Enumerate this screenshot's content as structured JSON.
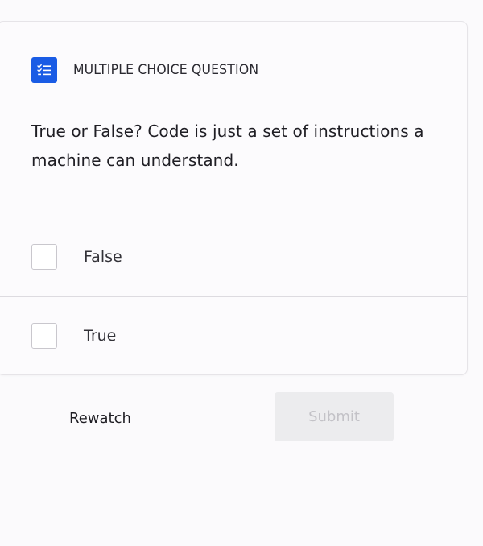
{
  "header": {
    "icon": "checklist-icon",
    "label": "MULTIPLE CHOICE QUESTION",
    "icon_color": "#1a5ce5"
  },
  "question": {
    "text": "True or False?  Code is just a set of instructions a machine can understand."
  },
  "options": [
    {
      "label": "False",
      "checked": false
    },
    {
      "label": "True",
      "checked": false
    }
  ],
  "actions": {
    "rewatch_label": "Rewatch",
    "submit_label": "Submit",
    "submit_disabled": true
  }
}
